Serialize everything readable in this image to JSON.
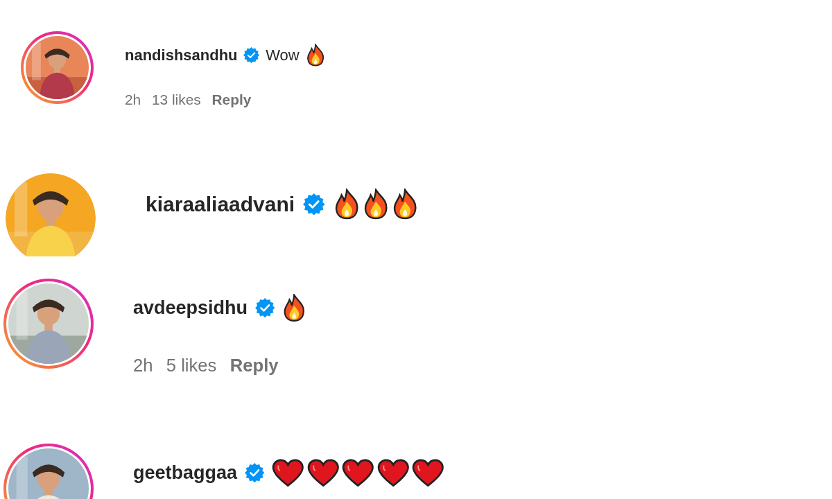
{
  "comments": [
    {
      "username": "nandishsandhu",
      "verified": true,
      "story_ring": true,
      "text": "Wow",
      "emojis": [
        {
          "kind": "fire"
        }
      ],
      "time": "2h",
      "likes": "13 likes",
      "reply": "Reply"
    },
    {
      "username": "kiaraaliaadvani",
      "verified": true,
      "story_ring": false,
      "emojis": [
        {
          "kind": "fire"
        },
        {
          "kind": "fire"
        },
        {
          "kind": "fire"
        }
      ]
    },
    {
      "username": "avdeepsidhu",
      "verified": true,
      "story_ring": true,
      "emojis": [
        {
          "kind": "fire"
        }
      ],
      "time": "2h",
      "likes": "5 likes",
      "reply": "Reply"
    },
    {
      "username": "geetbaggaa",
      "verified": true,
      "story_ring": true,
      "emojis": [
        {
          "kind": "heart"
        },
        {
          "kind": "heart"
        },
        {
          "kind": "heart"
        },
        {
          "kind": "heart"
        },
        {
          "kind": "heart"
        }
      ]
    }
  ]
}
